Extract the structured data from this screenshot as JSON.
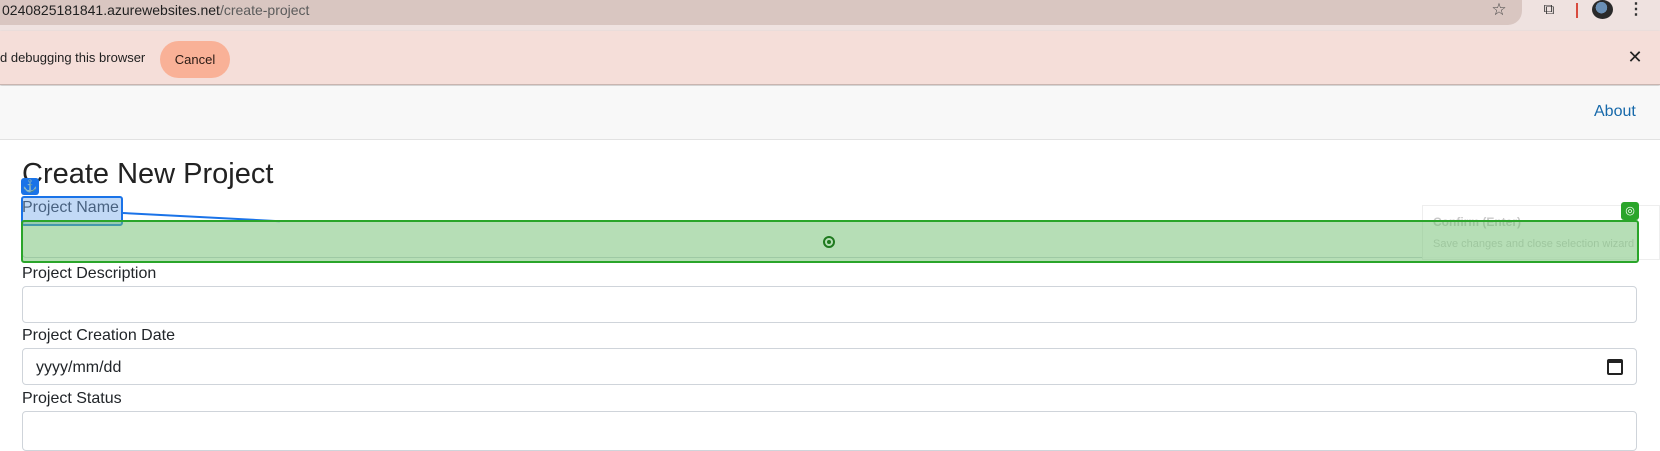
{
  "browser": {
    "url_host": "0240825181841.azurewebsites.net",
    "url_path": "/create-project",
    "star_icon": "star-icon",
    "extensions_icon": "puzzle-icon",
    "menu_icon": "kebab-menu-icon"
  },
  "infobar": {
    "message": "d debugging this browser",
    "cancel_label": "Cancel",
    "close_icon": "close-icon"
  },
  "nav": {
    "about_label": "About"
  },
  "form": {
    "title": "Create New Project",
    "name_label": "Project Name",
    "description_label": "Project Description",
    "date_label": "Project Creation Date",
    "date_placeholder": "yyyy/mm/dd",
    "status_label": "Project Status"
  },
  "overlay": {
    "anchor_icon": "anchor-icon",
    "target_icon": "crosshair-icon",
    "confirm_icon": "target-icon",
    "tooltip_title": "Confirm (Enter)",
    "tooltip_desc": "Save changes and close selection wizard",
    "colors": {
      "anchor": "#1a73e8",
      "target": "#2aa52a"
    }
  }
}
